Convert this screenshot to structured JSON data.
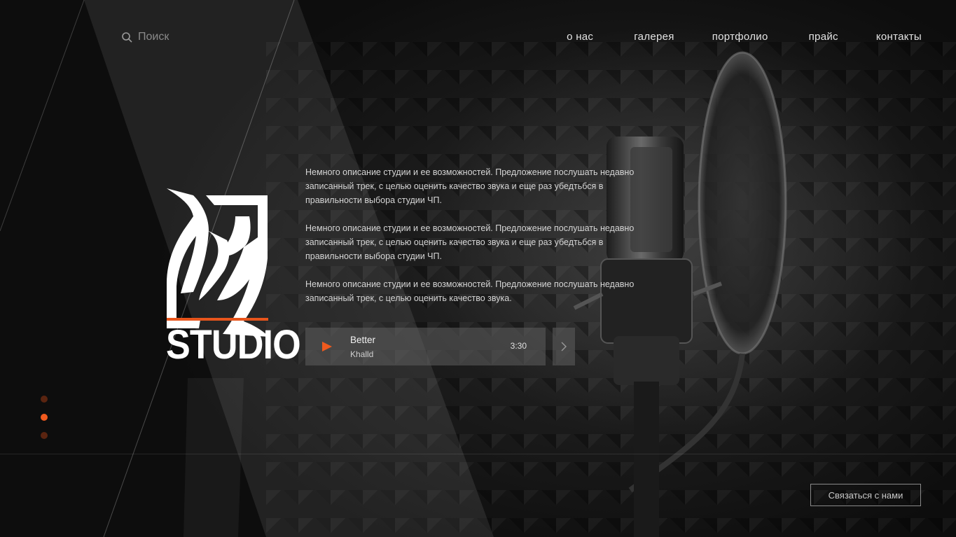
{
  "search": {
    "placeholder": "Поиск",
    "icon": "search-icon"
  },
  "nav": {
    "items": [
      {
        "label": "о нас"
      },
      {
        "label": "галерея"
      },
      {
        "label": "портфолио"
      },
      {
        "label": "прайс"
      },
      {
        "label": "контакты"
      }
    ]
  },
  "logo": {
    "word": "STUDIO"
  },
  "description": {
    "paragraphs": [
      "Немного описание студии и ее возможностей. Предложение послушать недавно записанный трек, с целью оценить качество звука и еще раз убедтьбся в правильности выбора студии ЧП.",
      "Немного описание студии и ее возможностей. Предложение послушать недавно записанный трек, с целью оценить качество звука и еще раз убедтьбся в правильности выбора студии ЧП.",
      "Немного описание студии и ее возможностей. Предложение послушать недавно записанный трек, с целью оценить качество звука."
    ]
  },
  "player": {
    "title": "Better",
    "artist": "Khalld",
    "duration": "3:30",
    "play_icon": "play-icon",
    "next_icon": "chevron-right-icon"
  },
  "pagination": {
    "count": 3,
    "active_index": 1
  },
  "cta": {
    "label": "Связаться с нами"
  },
  "colors": {
    "accent": "#f05a1e",
    "background": "#0b0b0b",
    "text": "#d8d8d8"
  }
}
